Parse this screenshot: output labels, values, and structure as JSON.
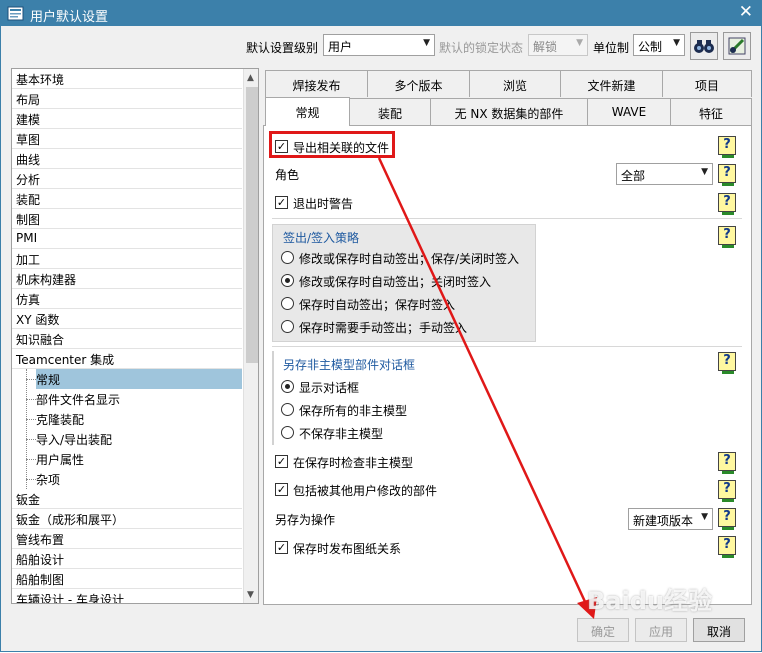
{
  "window": {
    "title": "用户默认设置",
    "close": "✕"
  },
  "toolbar": {
    "level_label": "默认设置级别",
    "level_value": "用户",
    "lock_label": "默认的锁定状态",
    "lock_value": "解锁",
    "unit_label": "单位制",
    "unit_value": "公制",
    "binoculars_icon": "binoculars-icon",
    "settings_icon": "manage-settings-icon"
  },
  "tree": {
    "items": [
      "基本环境",
      "布局",
      "建模",
      "草图",
      "曲线",
      "分析",
      "装配",
      "制图",
      "PMI",
      "加工",
      "机床构建器",
      "仿真",
      "XY 函数",
      "知识融合",
      "Teamcenter 集成"
    ],
    "children": [
      "常规",
      "部件文件名显示",
      "克隆装配",
      "导入/导出装配",
      "用户属性",
      "杂项"
    ],
    "items_after": [
      "钣金",
      "钣金（成形和展平）",
      "管线布置",
      "船舶设计",
      "船舶制图",
      "车辆设计 - 车身设计"
    ]
  },
  "tabs": {
    "row1": [
      "焊接发布",
      "多个版本",
      "浏览",
      "文件新建",
      "项目"
    ],
    "row2": [
      "常规",
      "装配",
      "无 NX 数据集的部件",
      "WAVE",
      "特征"
    ]
  },
  "content": {
    "export_files": "导出相关联的文件",
    "role_label": "角色",
    "role_value": "全部",
    "warn_exit": "退出时警告",
    "checkin_title": "签出/签入策略",
    "checkin_options": [
      "修改或保存时自动签出；保存/关闭时签入",
      "修改或保存时自动签出；关闭时签入",
      "保存时自动签出；保存时签入",
      "保存时需要手动签出；手动签入"
    ],
    "saveas_title": "另存非主模型部件对话框",
    "saveas_options": [
      "显示对话框",
      "保存所有的非主模型",
      "不保存非主模型"
    ],
    "check_nonmaster": "在保存时检查非主模型",
    "include_modified": "包括被其他用户修改的部件",
    "saveas_op_label": "另存为操作",
    "saveas_op_value": "新建项版本",
    "publish_relations": "保存时发布图纸关系",
    "help": "?"
  },
  "buttons": {
    "ok": "确定",
    "apply": "应用",
    "cancel": "取消"
  },
  "watermark": "Baidu经验",
  "colors": {
    "title_bar": "#3c80aa",
    "highlight": "#e01818",
    "selected_row": "#9fc5dc"
  }
}
